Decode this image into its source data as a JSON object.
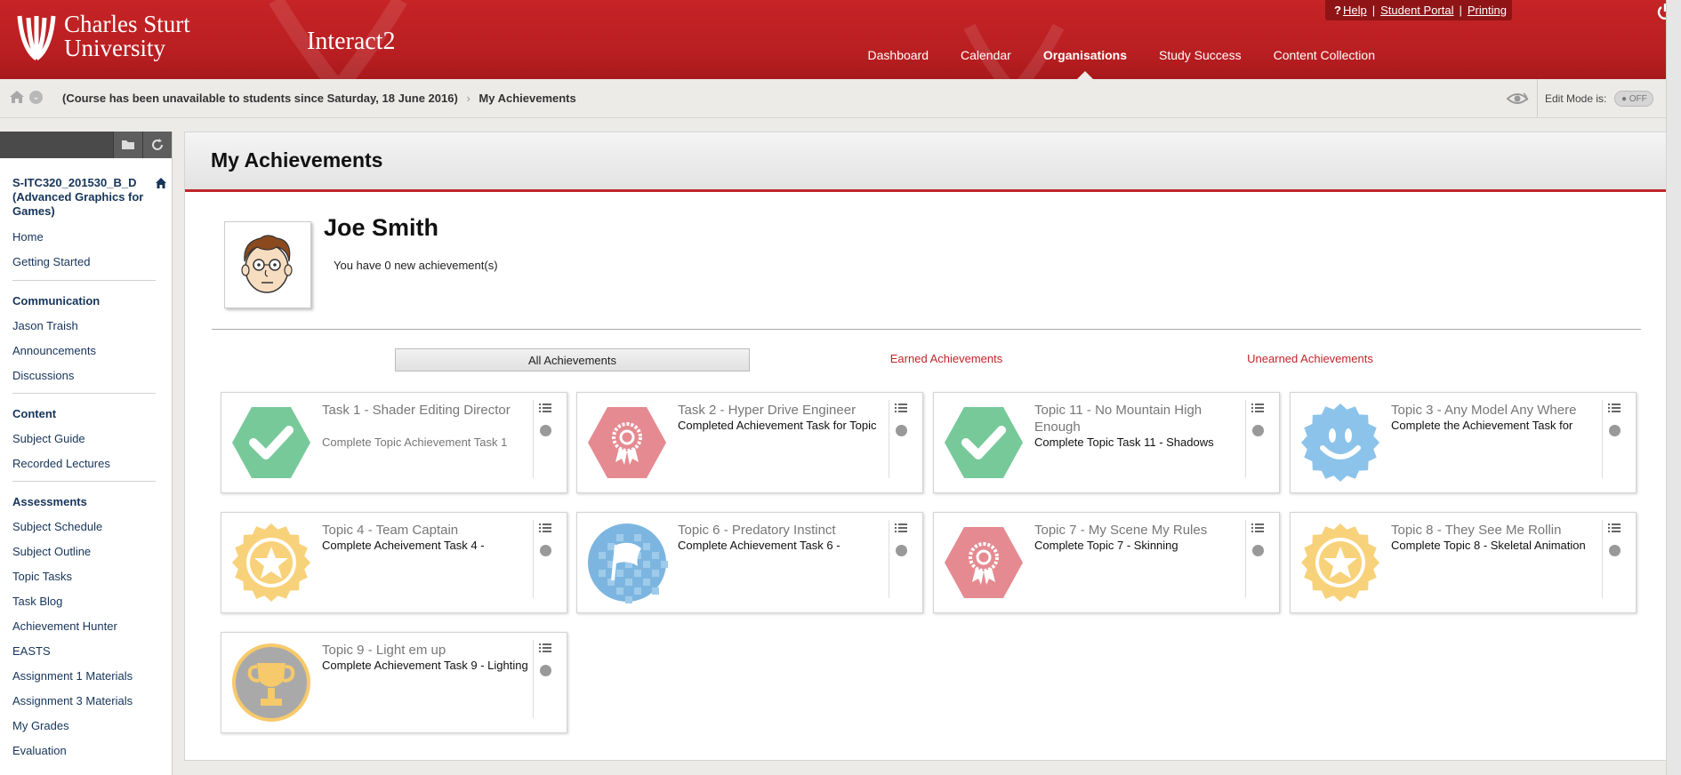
{
  "header": {
    "logo_line1": "Charles Sturt",
    "logo_line2": "University",
    "app_name": "Interact2",
    "utility": {
      "help": "Help",
      "student_portal": "Student Portal",
      "printing": "Printing"
    },
    "nav": [
      "Dashboard",
      "Calendar",
      "Organisations",
      "Study Success",
      "Content Collection"
    ],
    "active_nav": "Organisations"
  },
  "breadcrumb": {
    "course_status": "(Course has been unavailable to students since Saturday, 18 June 2016)",
    "current": "My Achievements",
    "edit_mode_label": "Edit Mode is:",
    "edit_mode_value": "OFF"
  },
  "sidebar": {
    "course_title": "S-ITC320_201530_B_D (Advanced Graphics for Games)",
    "top_links": [
      "Home",
      "Getting Started"
    ],
    "sections": [
      {
        "heading": "Communication",
        "links": [
          "Jason Traish",
          "Announcements",
          "Discussions"
        ]
      },
      {
        "heading": "Content",
        "links": [
          "Subject Guide",
          "Recorded Lectures"
        ]
      },
      {
        "heading": "Assessments",
        "links": [
          "Subject Schedule",
          "Subject Outline",
          "Topic Tasks",
          "Task Blog",
          "Achievement Hunter",
          "EASTS",
          "Assignment 1 Materials",
          "Assignment 3 Materials",
          "My Grades",
          "Evaluation"
        ]
      }
    ]
  },
  "main": {
    "page_title": "My Achievements",
    "user_name": "Joe Smith",
    "new_achievements": "You have 0 new achievement(s)",
    "filters": {
      "all": "All Achievements",
      "earned": "Earned Achievements",
      "unearned": "Unearned Achievements"
    },
    "achievements": [
      {
        "title": "Task 1 - Shader Editing Director",
        "desc": "Complete Topic Achievement Task 1",
        "badge": "green-check-hexagon",
        "desc_muted": true
      },
      {
        "title": "Task 2 - Hyper Drive Engineer",
        "desc": "Completed Achievement Task for Topic",
        "badge": "red-ribbon-hexagon"
      },
      {
        "title": "Topic 11 - No Mountain High Enough",
        "desc": "Complete Topic Task 11 - Shadows",
        "badge": "green-check-hexagon"
      },
      {
        "title": "Topic 3 - Any Model Any Where",
        "desc": "Complete the Achievement Task for",
        "badge": "blue-smiley-seal"
      },
      {
        "title": "Topic 4 - Team Captain",
        "desc": "Complete Acheivement Task 4 -",
        "badge": "gold-star-seal"
      },
      {
        "title": "Topic 6 - Predatory Instinct",
        "desc": "Complete Achievement Task 6 -",
        "badge": "blue-flag-circle"
      },
      {
        "title": "Topic 7 - My Scene My Rules",
        "desc": "Complete Topic 7 - Skinning",
        "badge": "red-ribbon-hexagon"
      },
      {
        "title": "Topic 8 - They See Me Rollin",
        "desc": "Complete Topic 8 - Skeletal Animation",
        "badge": "gold-star-seal"
      },
      {
        "title": "Topic 9 - Light em up",
        "desc": "Complete Achievement Task 9 - Lighting",
        "badge": "gray-trophy-circle"
      }
    ]
  },
  "colors": {
    "brand_red": "#c0252a",
    "header_red": "#b81e21",
    "nav_text": "#16345a"
  }
}
